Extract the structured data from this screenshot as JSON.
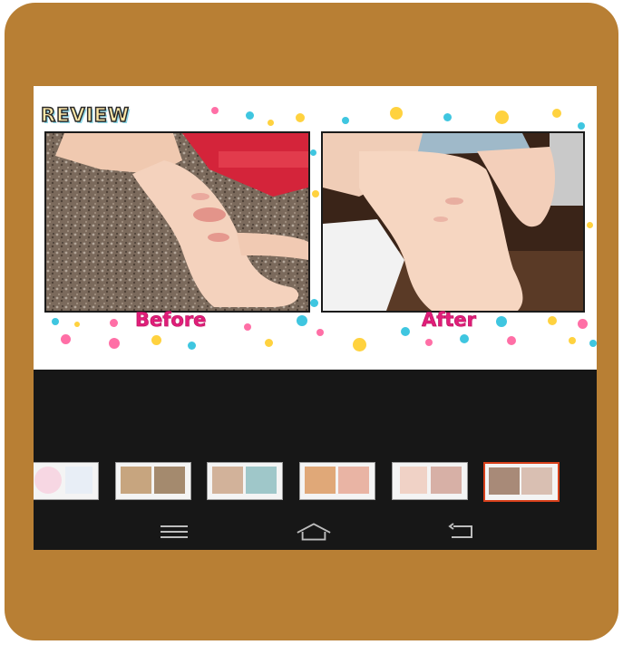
{
  "review": {
    "title": "REVIEW",
    "before_label": "Before",
    "after_label": "After"
  },
  "thumbnails": [
    {
      "name": "thumb-1",
      "selected": false
    },
    {
      "name": "thumb-2",
      "selected": false
    },
    {
      "name": "thumb-3",
      "selected": false
    },
    {
      "name": "thumb-4",
      "selected": false
    },
    {
      "name": "thumb-5",
      "selected": false
    },
    {
      "name": "thumb-6",
      "selected": true
    }
  ],
  "navbar": {
    "icons": [
      "menu-icon",
      "home-icon",
      "back-icon"
    ]
  },
  "colors": {
    "frame": "#b87f34",
    "screen": "#171717",
    "caption": "#e21d7a",
    "selected_border": "#d8401b"
  }
}
